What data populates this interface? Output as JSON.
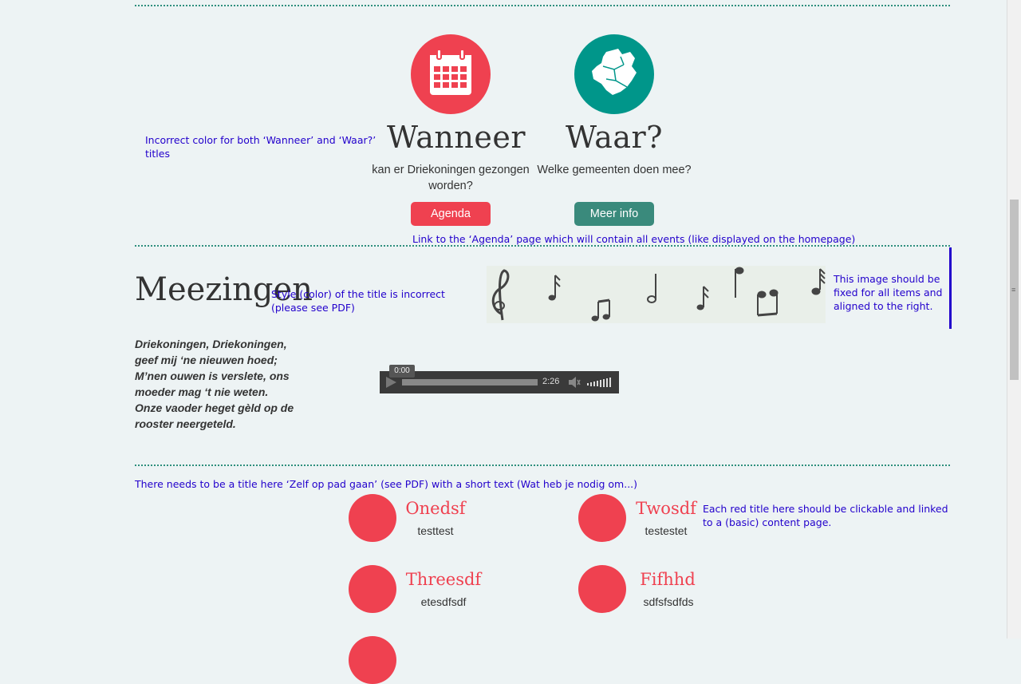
{
  "section_when_where": {
    "annotation": "Incorrect color for both ‘Wanneer’ and ‘Waar?’ titles",
    "when": {
      "title": "Wanneer",
      "subtitle": "kan er Driekoningen gezongen worden?",
      "button": "Agenda",
      "color": "#ef4150",
      "icon": "calendar-icon"
    },
    "where": {
      "title": "Waar?",
      "subtitle": "Welke gemeenten doen mee?",
      "button": "Meer info",
      "color": "#00968a",
      "button_color": "#3a8a7c",
      "icon": "map-icon"
    },
    "link_note": "Link to the ‘Agenda’ page which will contain all events (like displayed on the homepage)"
  },
  "section_sing": {
    "title": "Meezingen",
    "title_note": "Style (color) of the title is incorrect (please see PDF)",
    "image_note": "This image should be fixed for all items and aligned to the right.",
    "lyrics": [
      "Driekoningen, Driekoningen,",
      "geef mij ‘ne nieuwen hoed;",
      "M’nen ouwen is verslete, ons",
      "moeder mag ‘t nie weten.",
      "Onze vaoder heget gèld op de",
      "rooster neergeteld."
    ],
    "player": {
      "current_time": "0:00",
      "duration": "2:26",
      "progress": 0
    }
  },
  "section_items": {
    "title_note": "There needs to be a title here ‘Zelf op pad gaan’ (see PDF) with a short text (Wat heb je nodig om...)",
    "items_note": "Each red title here should be clickable and linked to a (basic) content page.",
    "items": [
      {
        "title": "Onedsf",
        "text": "testtest"
      },
      {
        "title": "Twosdf",
        "text": "testestet"
      },
      {
        "title": "Threesdf",
        "text": "etesdfsdf"
      },
      {
        "title": "Fifhhd",
        "text": "sdfsfsdfds"
      }
    ],
    "accent_color": "#ef4150"
  }
}
